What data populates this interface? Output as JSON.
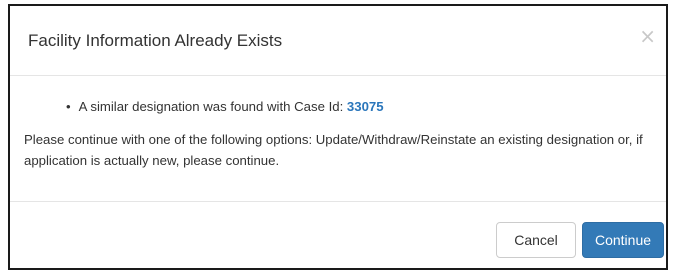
{
  "dialog": {
    "title": "Facility Information Already Exists",
    "close_label": "×",
    "bullet_prefix": "A similar designation was found with Case Id: ",
    "case_id": "33075",
    "message": "Please continue with one of the following options: Update/Withdraw/Reinstate an existing designation or, if application is actually new, please continue.",
    "cancel_label": "Cancel",
    "continue_label": "Continue"
  },
  "colors": {
    "primary": "#337ab7",
    "case_id": "#2a76bb",
    "close_icon": "#c8c8c8"
  }
}
